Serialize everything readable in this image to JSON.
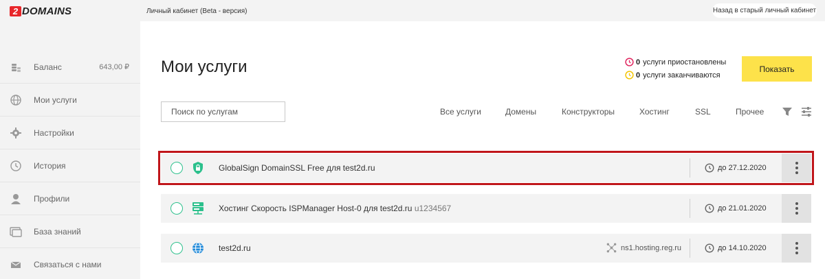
{
  "header": {
    "logo_digit": "2",
    "logo_text": "DOMAINS",
    "cabinet_title": "Личный кабинет (Beta - версия)",
    "old_cabinet_button": "Назад в старый личный кабинет"
  },
  "sidebar": {
    "items": [
      {
        "label": "Баланс",
        "value": "643,00 ₽",
        "icon": "coins-icon"
      },
      {
        "label": "Мои услуги",
        "icon": "globe-icon"
      },
      {
        "label": "Настройки",
        "icon": "gear-icon"
      },
      {
        "label": "История",
        "icon": "history-icon"
      },
      {
        "label": "Профили",
        "icon": "user-icon"
      },
      {
        "label": "База знаний",
        "icon": "book-icon"
      },
      {
        "label": "Связаться с нами",
        "icon": "envelope-icon"
      }
    ]
  },
  "main": {
    "title": "Мои услуги",
    "notices": [
      {
        "count": "0",
        "text": "услуги приостановлены",
        "icon": "clock-icon",
        "color": "#e0245e"
      },
      {
        "count": "0",
        "text": "услуги заканчиваются",
        "icon": "clock-icon",
        "color": "#f4c400"
      }
    ],
    "show_button": "Показать",
    "search_placeholder": "Поиск по услугам",
    "filters": [
      "Все услуги",
      "Домены",
      "Конструкторы",
      "Хостинг",
      "SSL",
      "Прочее"
    ],
    "services": [
      {
        "name": "GlobalSign DomainSSL Free для test2d.ru",
        "extra": "",
        "icon": "shield-lock-icon",
        "ns": "",
        "expiry": "до 27.12.2020",
        "selected": true
      },
      {
        "name": "Хостинг Скорость ISPManager Host-0 для test2d.ru",
        "extra": "u1234567",
        "icon": "server-icon",
        "ns": "",
        "expiry": "до 21.01.2020",
        "selected": false
      },
      {
        "name": "test2d.ru",
        "extra": "",
        "icon": "globe-icon",
        "ns": "ns1.hosting.reg.ru",
        "expiry": "до 14.10.2020",
        "selected": false
      }
    ]
  },
  "colors": {
    "accent_green": "#2cc08c",
    "button_yellow": "#fde24a",
    "selection_red": "#c0151a",
    "panel_gray": "#f3f3f3"
  }
}
